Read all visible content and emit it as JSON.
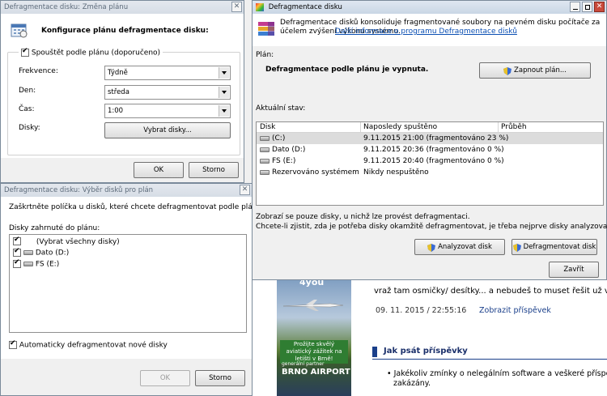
{
  "win_plan": {
    "title": "Defragmentace disku: Změna plánu",
    "heading": "Konfigurace plánu defragmentace disku:",
    "run_scheduled_label": "Spouštět podle plánu (doporučeno)",
    "frequency_label": "Frekvence:",
    "frequency_value": "Týdně",
    "day_label": "Den:",
    "day_value": "středa",
    "time_label": "Čas:",
    "time_value": "1:00",
    "disks_label": "Disky:",
    "select_disks_button": "Vybrat disky...",
    "ok_button": "OK",
    "cancel_button": "Storno"
  },
  "win_select": {
    "title": "Defragmentace disku: Výběr disků pro plán",
    "instructions": "Zaškrtněte políčka u disků, které chcete defragmentovat podle plánu.",
    "list_label": "Disky zahrnuté do plánu:",
    "items": [
      {
        "label": "(Vybrat všechny disky)",
        "checked": true
      },
      {
        "label": "Dato (D:)",
        "checked": true
      },
      {
        "label": "FS (E:)",
        "checked": true
      }
    ],
    "auto_label": "Automaticky defragmentovat nové disky",
    "ok_button": "OK",
    "cancel_button": "Storno"
  },
  "win_main": {
    "title": "Defragmentace disku",
    "description": "Defragmentace disků konsoliduje fragmentované soubory na pevném disku počítače za účelem zvýšení výkonu systému.",
    "more_info_link": "Další informace o programu Defragmentace disků",
    "plan_label": "Plán:",
    "plan_status": "Defragmentace podle plánu je vypnuta.",
    "enable_plan_button": "Zapnout plán...",
    "current_state_label": "Aktuální stav:",
    "columns": [
      "Disk",
      "Naposledy spuštěno",
      "Průběh"
    ],
    "rows": [
      {
        "disk": "(C:)",
        "last_run": "9.11.2015 21:00 (fragmentováno 23 %)",
        "progress": ""
      },
      {
        "disk": "Dato (D:)",
        "last_run": "9.11.2015 20:36 (fragmentováno 0 %)",
        "progress": ""
      },
      {
        "disk": "FS (E:)",
        "last_run": "9.11.2015 20:40 (fragmentováno 0 %)",
        "progress": ""
      },
      {
        "disk": "Rezervováno systémem",
        "last_run": "Nikdy nespuštěno",
        "progress": ""
      }
    ],
    "note1": "Zobrazí se pouze disky, u nichž lze provést defragmentaci.",
    "note2": "Chcete-li zjistit, zda je potřeba disky okamžitě defragmentovat, je třeba nejprve disky analyzovat.",
    "analyze_button": "Analyzovat disk",
    "defrag_button": "Defragmentovat disk",
    "close_button": "Zavřít"
  },
  "background_page": {
    "ad_top": "4you",
    "ad_text": "Prožijte skvělý aviatický zážitek na letišti v Brně!",
    "ad_partner": "generální partner",
    "ad_brand": "BRNO AIRPORT",
    "post_text": "vraž tam osmičky/ desítky... a nebudeš to muset řešit už vůbec :",
    "post_date": "09. 11. 2015 / 22:55:16",
    "post_link": "Zobrazit příspěvek",
    "section_title": "Jak psát příspěvky",
    "bullet_text": "Jakékoliv zmínky o nelegálním software a veškeré příspěvky",
    "bullet_text2": "zakázány."
  }
}
